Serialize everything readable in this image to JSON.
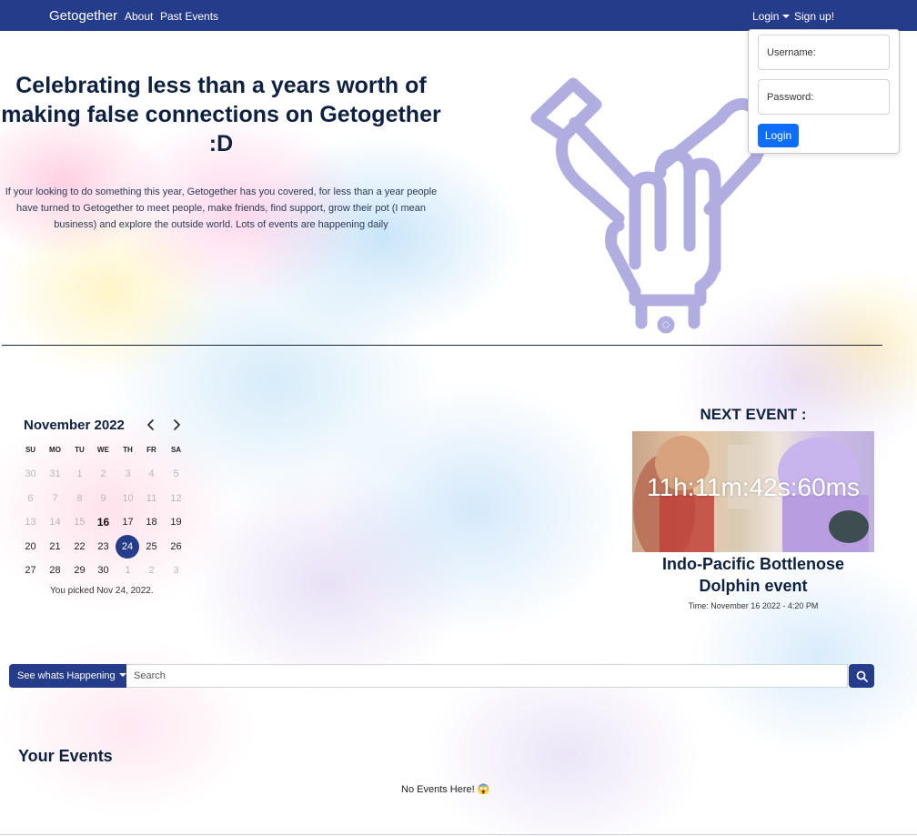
{
  "navbar": {
    "brand": "Getogether",
    "links": [
      "About",
      "Past Events"
    ],
    "login_label": "Login",
    "signup_label": "Sign up!"
  },
  "login_form": {
    "username_placeholder": "Username:",
    "password_placeholder": "Password:",
    "submit_label": "Login",
    "submit_color": "#0d6efd"
  },
  "hero": {
    "title": "Celebrating less than a years worth of making false connections on Getogether :D",
    "text": "If your looking to do something this year, Getogether has you covered, for less than a year people have turned to Getogether to meet people, make friends, find support, grow their pot (I mean business) and explore the outside world. Lots of events are happening daily",
    "illustration_icon": "stacked-hands-icon",
    "illustration_color": "#b1ade0"
  },
  "calendar": {
    "month_label": "November 2022",
    "weekdays": [
      "SU",
      "MO",
      "TU",
      "WE",
      "TH",
      "FR",
      "SA"
    ],
    "weeks": [
      [
        "30",
        "31",
        "1",
        "2",
        "3",
        "4",
        "5"
      ],
      [
        "6",
        "7",
        "8",
        "9",
        "10",
        "11",
        "12"
      ],
      [
        "13",
        "14",
        "15",
        "16",
        "17",
        "18",
        "19"
      ],
      [
        "20",
        "21",
        "22",
        "23",
        "24",
        "25",
        "26"
      ],
      [
        "27",
        "28",
        "29",
        "30",
        "1",
        "2",
        "3"
      ]
    ],
    "today": "16",
    "selected": "24",
    "picked_text": "You picked Nov 24, 2022."
  },
  "next_event": {
    "label": "NEXT EVENT :",
    "countdown": "11h:11m:42s:60ms",
    "name": "Indo-Pacific Bottlenose Dolphin event",
    "time": "Time: November 16 2022 - 4:20 PM"
  },
  "search": {
    "dropdown_label": "See whats Happening",
    "placeholder": "Search",
    "button_icon": "search-icon"
  },
  "your_events": {
    "title": "Your Events",
    "empty_text": "No Events Here! 😱"
  },
  "colors": {
    "primary": "#253c8a",
    "heading": "#0f2140"
  }
}
